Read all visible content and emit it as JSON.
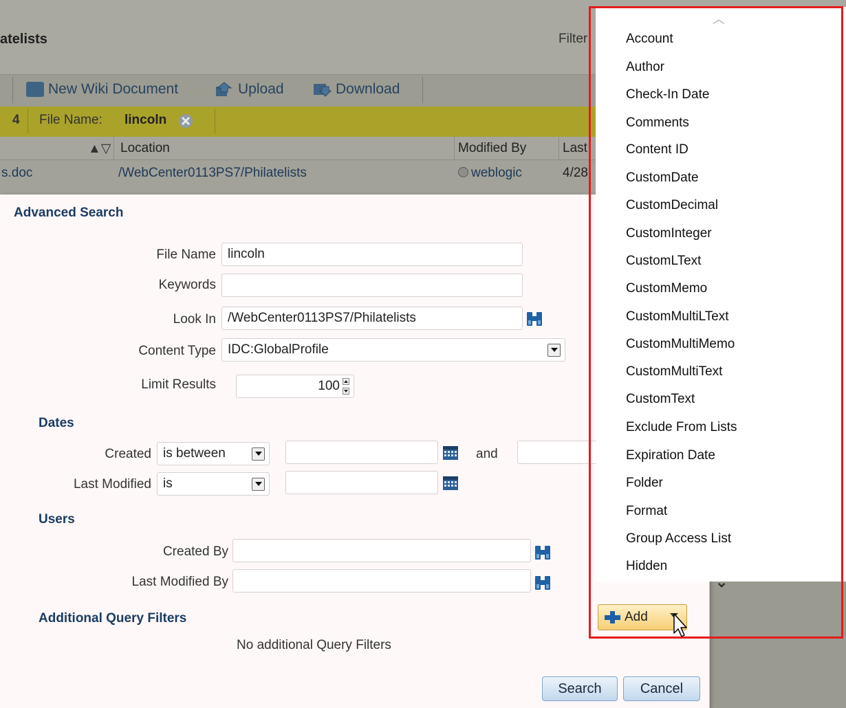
{
  "background": {
    "title_fragment": "atelists",
    "filter_label": "Filter",
    "toolbar": {
      "new_wiki": "New Wiki Document",
      "upload": "Upload",
      "download": "Download"
    },
    "filter_bar": {
      "count_fragment": "4",
      "file_name_label": "File Name:",
      "file_name_value": "lincoln"
    },
    "columns": {
      "sort_arrows": "▲▽",
      "location": "Location",
      "modified_by": "Modified By",
      "last_fragment": "Last"
    },
    "row1": {
      "name_fragment": "s.doc",
      "location": "/WebCenter0113PS7/Philatelists",
      "modified_by": "weblogic",
      "date_fragment": "4/28"
    }
  },
  "dialog": {
    "title": "Advanced Search",
    "file_name": {
      "label": "File Name",
      "value": "lincoln"
    },
    "keywords": {
      "label": "Keywords",
      "value": ""
    },
    "look_in": {
      "label": "Look In",
      "value": "/WebCenter0113PS7/Philatelists"
    },
    "content_type": {
      "label": "Content Type",
      "value": "IDC:GlobalProfile"
    },
    "limit_results": {
      "label": "Limit Results",
      "value": "100"
    },
    "dates": {
      "heading": "Dates",
      "created": {
        "label": "Created",
        "operator": "is between",
        "and_label": "and"
      },
      "last_modified": {
        "label": "Last Modified",
        "operator": "is"
      }
    },
    "users": {
      "heading": "Users",
      "created_by": {
        "label": "Created By",
        "value": ""
      },
      "last_modified_by": {
        "label": "Last Modified By",
        "value": ""
      }
    },
    "additional": {
      "heading": "Additional Query Filters",
      "empty_text": "No additional Query Filters"
    },
    "search_button": "Search",
    "cancel_button": "Cancel"
  },
  "popup": {
    "items": [
      "Account",
      "Author",
      "Check-In Date",
      "Comments",
      "Content ID",
      "CustomDate",
      "CustomDecimal",
      "CustomInteger",
      "CustomLText",
      "CustomMemo",
      "CustomMultiLText",
      "CustomMultiMemo",
      "CustomMultiText",
      "CustomText",
      "Exclude From Lists",
      "Expiration Date",
      "Folder",
      "Format",
      "Group Access List",
      "Hidden"
    ],
    "scroll_up_glyph": "︿",
    "scroll_down_glyph": "⌄",
    "add_button": "Add"
  },
  "colors": {
    "highlight": "#e41b1b",
    "dialog_bg": "#fff8f8",
    "heading": "#1a3d63",
    "filter_bar": "#aaa32a"
  }
}
